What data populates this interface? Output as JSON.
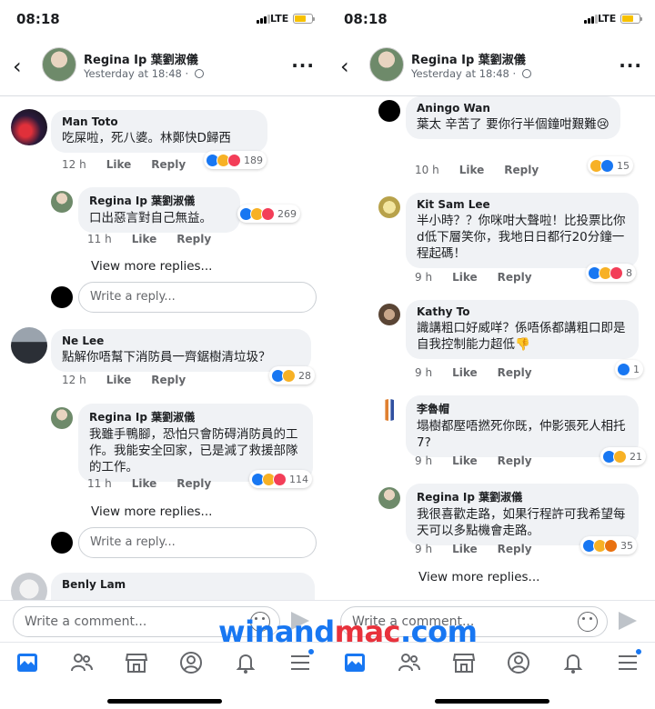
{
  "status": {
    "time": "08:18",
    "network": "LTE"
  },
  "header": {
    "name": "Regina Ip 葉劉淑儀",
    "meta": "Yesterday at 18:48 · "
  },
  "labels": {
    "like": "Like",
    "reply": "Reply",
    "view_more": "View more replies...",
    "write_reply": "Write a reply...",
    "write_comment": "Write a comment..."
  },
  "left": [
    {
      "name": "Man Toto",
      "text": "吃屎啦，死八婆。林鄭快D歸西",
      "time": "12 h",
      "reactions": [
        "like",
        "haha",
        "love"
      ],
      "count": "189"
    },
    {
      "name": "Regina Ip 葉劉淑儀",
      "text": "口出惡言對自己無益。",
      "time": "11 h",
      "reactions": [
        "like",
        "haha",
        "love"
      ],
      "count": "269"
    },
    {
      "name": "Ne Lee",
      "text": "點解你唔幫下消防員一齊鋸樹清垃圾？",
      "time": "12 h",
      "reactions": [
        "like",
        "haha"
      ],
      "count": "28"
    },
    {
      "name": "Regina Ip 葉劉淑儀",
      "text": "我雖手鴨腳，恐怕只會防碍消防員的工作。我能安全回家，已是減了救援部隊的工作。",
      "time": "11 h",
      "reactions": [
        "like",
        "haha",
        "love"
      ],
      "count": "114"
    },
    {
      "name": "Benly Lam",
      "text": "",
      "time": "",
      "reactions": [],
      "count": ""
    }
  ],
  "right": [
    {
      "name": "Aningo Wan",
      "text": "葉太 辛苦了 要你行半個鐘咁艱難😢",
      "time": "10 h",
      "reactions": [
        "haha",
        "like"
      ],
      "count": "15"
    },
    {
      "name": "Kit Sam  Lee",
      "text": "半小時？？你咪咁大聲啦！比投票比你d低下層笑你，我地日日都行20分鐘一程起碼！",
      "time": "9 h",
      "reactions": [
        "like",
        "haha",
        "love"
      ],
      "count": "8"
    },
    {
      "name": "Kathy To",
      "text": "識講粗口好威咩？係唔係都講粗口即是自我控制能力超低👎",
      "time": "9 h",
      "reactions": [
        "like"
      ],
      "count": "1"
    },
    {
      "name": "李魯帽",
      "text": "塌樹都壓唔撚死你既，仲影張死人相托7?",
      "time": "9 h",
      "reactions": [
        "like",
        "haha"
      ],
      "count": "21"
    },
    {
      "name": "Regina Ip 葉劉淑儀",
      "text": "我很喜歡走路，如果行程許可我希望每天可以多點機會走路。",
      "time": "9 h",
      "reactions": [
        "like",
        "haha",
        "angry"
      ],
      "count": "35"
    }
  ],
  "watermark": {
    "part1": "winand",
    "part2": "mac",
    "part3": ".com"
  },
  "colors": {
    "accent": "#1877f2",
    "bubble": "#f0f2f5"
  }
}
